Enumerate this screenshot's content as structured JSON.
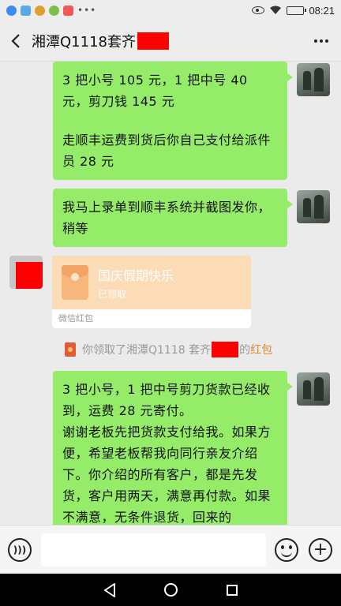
{
  "status_bar": {
    "time": "08:21",
    "battery_level": 0.85,
    "icons": [
      "app-icon-blue",
      "app-icon-lightblue",
      "app-icon-green",
      "app-icon-yellow",
      "app-icon-red",
      "overflow-dots-icon",
      "eye-icon",
      "wifi-icon",
      "battery-icon"
    ]
  },
  "header": {
    "title": "湘潭Q1118套齐"
  },
  "messages": [
    {
      "side": "right",
      "paragraphs": [
        "3 把小号 105 元，1 把中号 40 元，剪刀钱 145 元",
        "走顺丰运费到货后你自己支付给派件员 28 元"
      ]
    },
    {
      "side": "right",
      "paragraphs": [
        "我马上录单到顺丰系统并截图发你，稍等"
      ]
    },
    {
      "side": "left",
      "type": "red_packet",
      "title": "国庆假期快乐",
      "status": "已领取",
      "footer": "微信红包"
    },
    {
      "type": "notice",
      "text_before": "你领取了湘潭Q1118 套齐",
      "text_after": "的",
      "link": "红包"
    },
    {
      "side": "right",
      "paragraphs": [
        "3 把小号，1 把中号剪刀货款已经收到，运费 28 元寄付。",
        "谢谢老板先把货款支付给我。如果方便，希望老板帮我向同行亲友介绍下。你介绍的所有客户，都是先发货，客户用两天，满意再付款。如果不满意，无条件退货，回来的"
      ]
    }
  ],
  "input_bar": {
    "placeholder": "",
    "plus_label": "+"
  },
  "colors": {
    "bubble_green": "#95ec69",
    "packet_bg": "#fbdcb7",
    "notice_link": "#e08a2a",
    "redaction": "#ff0000"
  }
}
